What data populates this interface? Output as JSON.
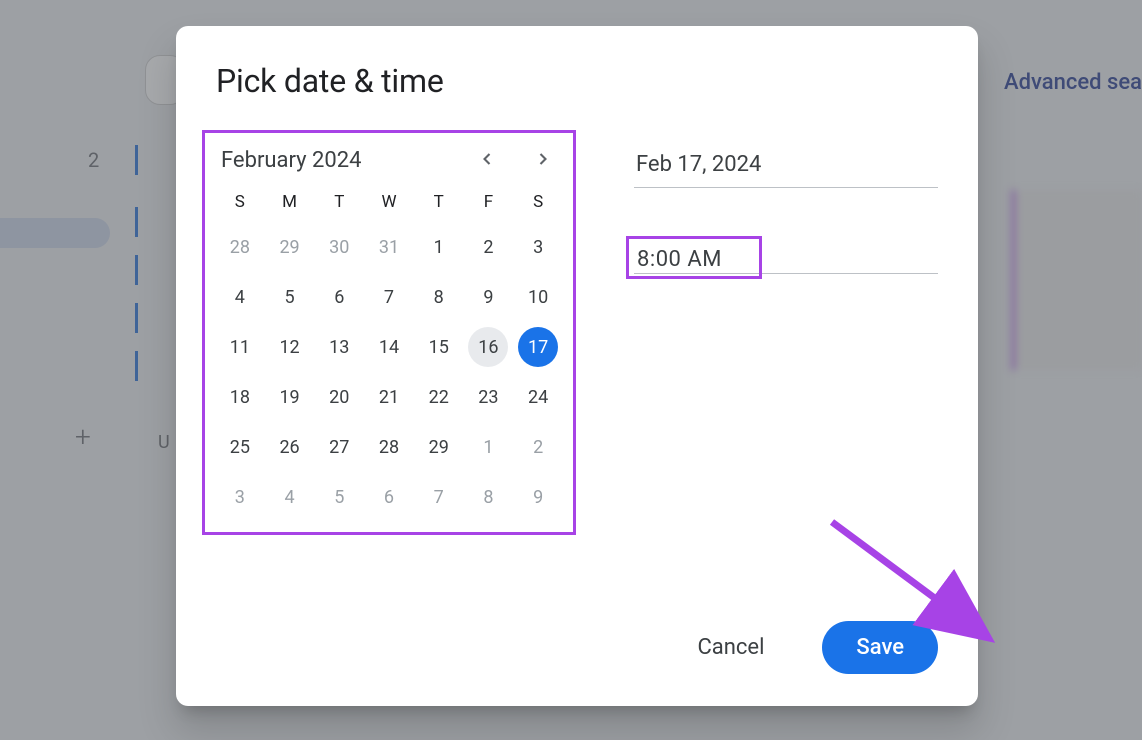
{
  "bg": {
    "advanced_search": "Advanced sea",
    "sidebar_number": "2",
    "sidebar_u": "U"
  },
  "dialog": {
    "title": "Pick date & time",
    "date_value": "Feb 17, 2024",
    "time_value": "8:00 AM",
    "cancel": "Cancel",
    "save": "Save"
  },
  "calendar": {
    "month_label": "February 2024",
    "dow": [
      "S",
      "M",
      "T",
      "W",
      "T",
      "F",
      "S"
    ],
    "today": 16,
    "selected": 17,
    "weeks": [
      [
        {
          "n": 28,
          "o": true
        },
        {
          "n": 29,
          "o": true
        },
        {
          "n": 30,
          "o": true
        },
        {
          "n": 31,
          "o": true
        },
        {
          "n": 1
        },
        {
          "n": 2
        },
        {
          "n": 3
        }
      ],
      [
        {
          "n": 4
        },
        {
          "n": 5
        },
        {
          "n": 6
        },
        {
          "n": 7
        },
        {
          "n": 8
        },
        {
          "n": 9
        },
        {
          "n": 10
        }
      ],
      [
        {
          "n": 11
        },
        {
          "n": 12
        },
        {
          "n": 13
        },
        {
          "n": 14
        },
        {
          "n": 15
        },
        {
          "n": 16
        },
        {
          "n": 17
        }
      ],
      [
        {
          "n": 18
        },
        {
          "n": 19
        },
        {
          "n": 20
        },
        {
          "n": 21
        },
        {
          "n": 22
        },
        {
          "n": 23
        },
        {
          "n": 24
        }
      ],
      [
        {
          "n": 25
        },
        {
          "n": 26
        },
        {
          "n": 27
        },
        {
          "n": 28
        },
        {
          "n": 29
        },
        {
          "n": 1,
          "o": true
        },
        {
          "n": 2,
          "o": true
        }
      ],
      [
        {
          "n": 3,
          "o": true
        },
        {
          "n": 4,
          "o": true
        },
        {
          "n": 5,
          "o": true
        },
        {
          "n": 6,
          "o": true
        },
        {
          "n": 7,
          "o": true
        },
        {
          "n": 8,
          "o": true
        },
        {
          "n": 9,
          "o": true
        }
      ]
    ]
  }
}
